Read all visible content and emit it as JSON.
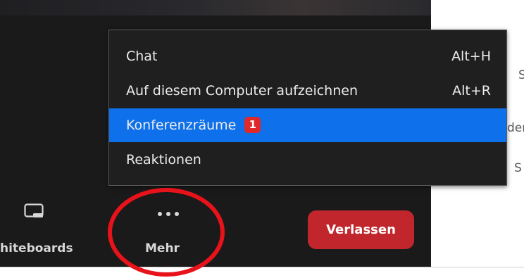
{
  "menu": {
    "items": [
      {
        "label": "Chat",
        "shortcut": "Alt+H"
      },
      {
        "label": "Auf diesem Computer aufzeichnen",
        "shortcut": "Alt+R"
      },
      {
        "label": "Konferenzräume",
        "badge": "1"
      },
      {
        "label": "Reaktionen"
      }
    ]
  },
  "toolbar": {
    "whiteboards_label": "hiteboards",
    "more_label": "Mehr",
    "leave_label": "Verlassen"
  },
  "side_panel": {
    "fragments": [
      "S",
      "der",
      "S"
    ]
  },
  "colors": {
    "menu_highlight": "#0e71eb",
    "badge": "#e02828",
    "leave_button": "#c0262c",
    "annotation_circle": "#e8121a"
  },
  "icons": [
    "whiteboard-icon",
    "more-dots-icon"
  ]
}
